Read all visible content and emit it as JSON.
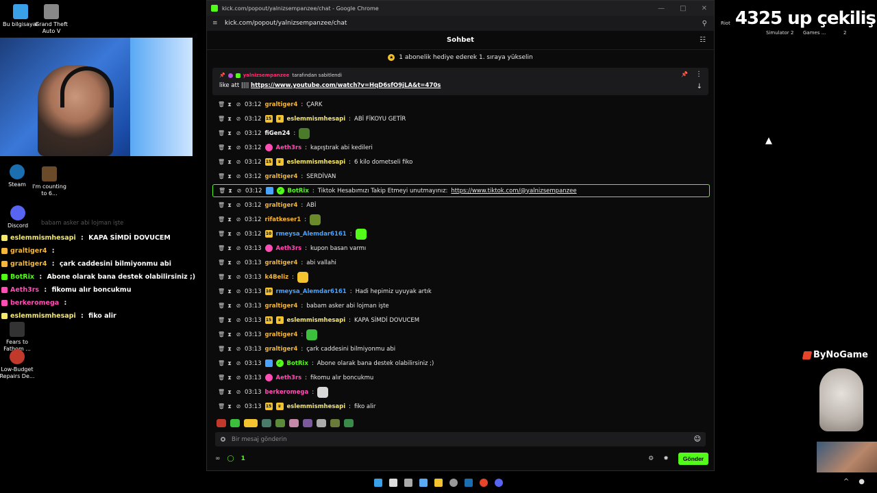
{
  "desktop": {
    "icons": [
      {
        "label": "Bu bilgisayar",
        "color": "#3aa0e8"
      },
      {
        "label": "Grand Theft Auto V",
        "color": "#888888"
      },
      {
        "label": "Steam",
        "color": "#1b6fb0"
      },
      {
        "label": "I'm counting to 6...",
        "color": "#6b4a2a"
      },
      {
        "label": "Discord",
        "color": "#5865f2"
      },
      {
        "label": "Fears to Fathom ...",
        "color": "#333333"
      },
      {
        "label": "Low-Budget Repairs De...",
        "color": "#c0392b"
      }
    ],
    "top_right_icons": [
      "Riot",
      "Simulator 2",
      "Games ...",
      "2"
    ]
  },
  "overlay_chat": [
    {
      "user": "eslemmismhesapi",
      "user_color": "#f6e86b",
      "sep": " : ",
      "text": "KAPA SİMDİ DOVUCEM"
    },
    {
      "user": "graltiger4",
      "user_color": "#f4b73a",
      "sep": " : ",
      "text": ""
    },
    {
      "user": "graltiger4",
      "user_color": "#f4b73a",
      "sep": " : ",
      "text": "çark caddesini bilmiyonmu abi"
    },
    {
      "user": "BotRix",
      "user_color": "#53fc18",
      "sep": " : ",
      "text": "Abone olarak bana destek olabilirsiniz ;)"
    },
    {
      "user": "Aeth3rs",
      "user_color": "#ff4fb5",
      "sep": " : ",
      "text": "fikomu alır boncukmu"
    },
    {
      "user": "berkeromega",
      "user_color": "#ff4fb5",
      "sep": " : ",
      "text": ""
    },
    {
      "user": "eslemmismhesapi",
      "user_color": "#f6e86b",
      "sep": " : ",
      "text": "fiko alir"
    }
  ],
  "overlay_ghost_text": "babam asker abi lojman işte",
  "browser": {
    "title": "kick.com/popout/yalnizsempanzee/chat - Google Chrome",
    "url": "kick.com/popout/yalnizsempanzee/chat"
  },
  "chat": {
    "header": "Sohbet",
    "sub_goal": "1 abonelik hediye ederek 1. sıraya yükselin",
    "pinned": {
      "pinned_by_user": "yalnizsempanzee",
      "pinned_by_suffix": "tarafından sabitlendi",
      "text_prefix": "like att ||||",
      "link": "https://www.youtube.com/watch?v=HqD6sfO9jLA&t=470s"
    },
    "messages": [
      {
        "time": "03:12",
        "badge": "",
        "user": "graltiger4",
        "user_color": "#f4b73a",
        "text": "ÇARK",
        "emote": ""
      },
      {
        "time": "03:12",
        "badge": "15",
        "crown": true,
        "user": "eslemmismhesapi",
        "user_color": "#f6e86b",
        "text": "ABİ FİKOYU GETİR",
        "emote": ""
      },
      {
        "time": "03:12",
        "badge": "",
        "user": "fiGen24",
        "user_color": "#ffffff",
        "text": "",
        "emote": "#4a7a2a"
      },
      {
        "time": "03:12",
        "badge": "sub",
        "user": "Aeth3rs",
        "user_color": "#ff4fb5",
        "text": "kapıştırak abi kedileri",
        "emote": ""
      },
      {
        "time": "03:12",
        "badge": "15",
        "crown": true,
        "user": "eslemmismhesapi",
        "user_color": "#f6e86b",
        "text": "6 kilo dometseli fiko",
        "emote": ""
      },
      {
        "time": "03:12",
        "badge": "",
        "user": "graltiger4",
        "user_color": "#f4b73a",
        "text": "SERDİVAN",
        "emote": ""
      },
      {
        "time": "03:12",
        "badge": "bot",
        "verified": true,
        "user": "BotRix",
        "user_color": "#53fc18",
        "text": "Tiktok Hesabımızı Takip Etmeyi unutmayınız:",
        "link": "https://www.tiktok.com/@yalnizsempanzee",
        "highlight": true
      },
      {
        "time": "03:12",
        "badge": "",
        "user": "graltiger4",
        "user_color": "#f4b73a",
        "text": "ABİ",
        "emote": ""
      },
      {
        "time": "03:12",
        "badge": "",
        "user": "rifatkeser1",
        "user_color": "#f4b73a",
        "text": "",
        "emote": "#6b8a2a"
      },
      {
        "time": "03:12",
        "badge": "10",
        "user": "rmeysa_Alemdar6161",
        "user_color": "#4aa3ff",
        "text": "",
        "emote": "#53fc18"
      },
      {
        "time": "03:13",
        "badge": "sub",
        "user": "Aeth3rs",
        "user_color": "#ff4fb5",
        "text": "kupon basan varmı",
        "emote": ""
      },
      {
        "time": "03:13",
        "badge": "",
        "user": "graltiger4",
        "user_color": "#f4b73a",
        "text": "abi vallahi",
        "emote": ""
      },
      {
        "time": "03:13",
        "badge": "",
        "user": "k4Beliz",
        "user_color": "#f4b73a",
        "text": "",
        "emote": "#f4c430"
      },
      {
        "time": "03:13",
        "badge": "10",
        "user": "rmeysa_Alemdar6161",
        "user_color": "#4aa3ff",
        "text": "Hadi hepimiz uyuyak artık",
        "emote": ""
      },
      {
        "time": "03:13",
        "badge": "",
        "user": "graltiger4",
        "user_color": "#f4b73a",
        "text": "babam asker abi lojman işte",
        "emote": ""
      },
      {
        "time": "03:13",
        "badge": "15",
        "crown": true,
        "user": "eslemmismhesapi",
        "user_color": "#f6e86b",
        "text": "KAPA SİMDİ DOVUCEM",
        "emote": ""
      },
      {
        "time": "03:13",
        "badge": "",
        "user": "graltiger4",
        "user_color": "#f4b73a",
        "text": "",
        "emote": "#3cbf3c"
      },
      {
        "time": "03:13",
        "badge": "",
        "user": "graltiger4",
        "user_color": "#f4b73a",
        "text": "çark caddesini bilmiyonmu abi",
        "emote": ""
      },
      {
        "time": "03:13",
        "badge": "bot",
        "verified": true,
        "user": "BotRix",
        "user_color": "#53fc18",
        "text": "Abone olarak bana destek olabilirsiniz ;)",
        "emote": ""
      },
      {
        "time": "03:13",
        "badge": "sub",
        "user": "Aeth3rs",
        "user_color": "#ff4fb5",
        "text": "fikomu alır boncukmu",
        "emote": ""
      },
      {
        "time": "03:13",
        "badge": "",
        "user": "berkeromega",
        "user_color": "#ff4fb5",
        "text": "",
        "emote": "#d8d8d8"
      },
      {
        "time": "03:13",
        "badge": "15",
        "crown": true,
        "user": "eslemmismhesapi",
        "user_color": "#f6e86b",
        "text": "fiko alir",
        "emote": ""
      }
    ],
    "input_placeholder": "Bir mesaj gönderin",
    "viewer_count": "1",
    "send_label": "Gönder"
  },
  "overlay_right": {
    "raffle_text": "4325 up çekiliş",
    "brand": "ByNoGame"
  },
  "colors": {
    "kick_green": "#53fc18",
    "bg": "#0b0b0c"
  }
}
